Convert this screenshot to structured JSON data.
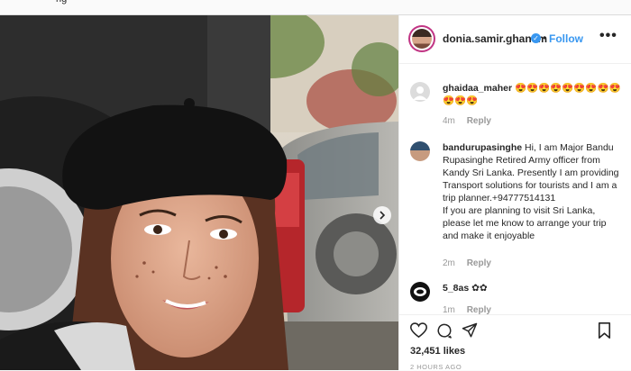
{
  "top_fragment": "ng",
  "post": {
    "username": "donia.samir.ghanem",
    "verified_mark": "✓",
    "separator": "•",
    "follow_label": "Follow",
    "more_label": "•••",
    "likes": "32,451 likes",
    "timestamp": "2 HOURS AGO"
  },
  "comments": [
    {
      "user": "ghaidaa_maher",
      "text": "😍😍😍😍😍😍😍😍😍😍😍😍",
      "age": "4m",
      "reply_label": "Reply"
    },
    {
      "user": "bandurupasinghe",
      "text": "Hi, I am Major Bandu Rupasinghe Retired Army officer from Kandy Sri Lanka. Presently I am providing Transport solutions for tourists and I am a trip planner.+94777514131\nIf you are planning to visit Sri Lanka, please let me know to arrange your trip and make it enjoyable",
      "age": "2m",
      "reply_label": "Reply"
    },
    {
      "user": "5_8as",
      "text": "✿✿",
      "age": "1m",
      "reply_label": "Reply"
    }
  ],
  "icons": {
    "like": "heart-icon",
    "comment": "comment-bubble-icon",
    "share": "share-icon",
    "save": "bookmark-icon",
    "next": "chevron-right-icon",
    "verified": "verified-badge-icon"
  },
  "colors": {
    "accent_blue": "#3897f0",
    "text": "#262626",
    "muted": "#999999",
    "divider": "#efefef"
  }
}
